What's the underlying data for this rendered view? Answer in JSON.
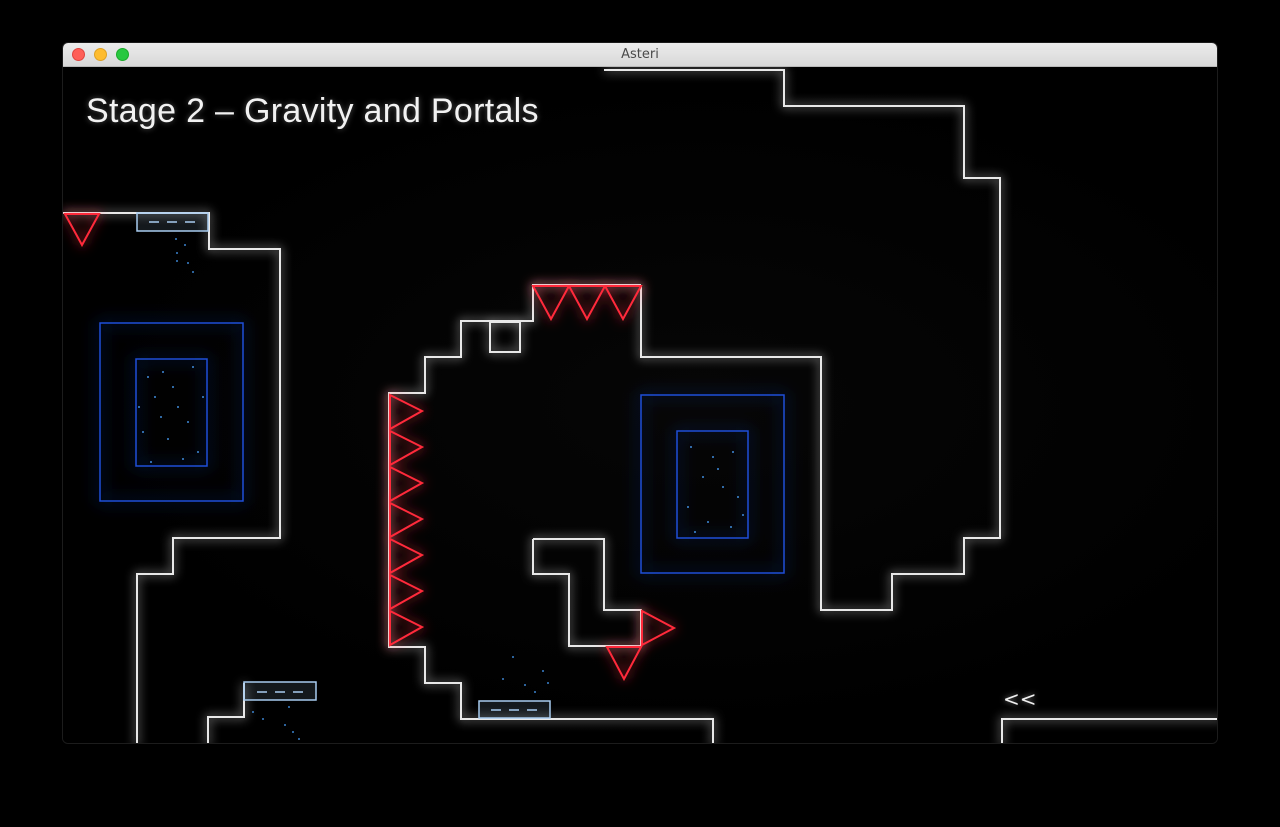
{
  "window": {
    "title": "Asteri"
  },
  "hud": {
    "stage_title": "Stage 2 – Gravity and Portals",
    "exit_indicator": "<<"
  },
  "colors": {
    "wall": "#e8e8e8",
    "spike": "#ff2a3a",
    "portal": "#1f4fd8",
    "gravity_pad": "#a8ccf0",
    "particle": "#4aa3ff",
    "background": "#000000"
  },
  "icons": {
    "spike": "triangle-spike-icon",
    "portal": "portal-icon",
    "gravity_pad": "gravity-pad-icon"
  }
}
